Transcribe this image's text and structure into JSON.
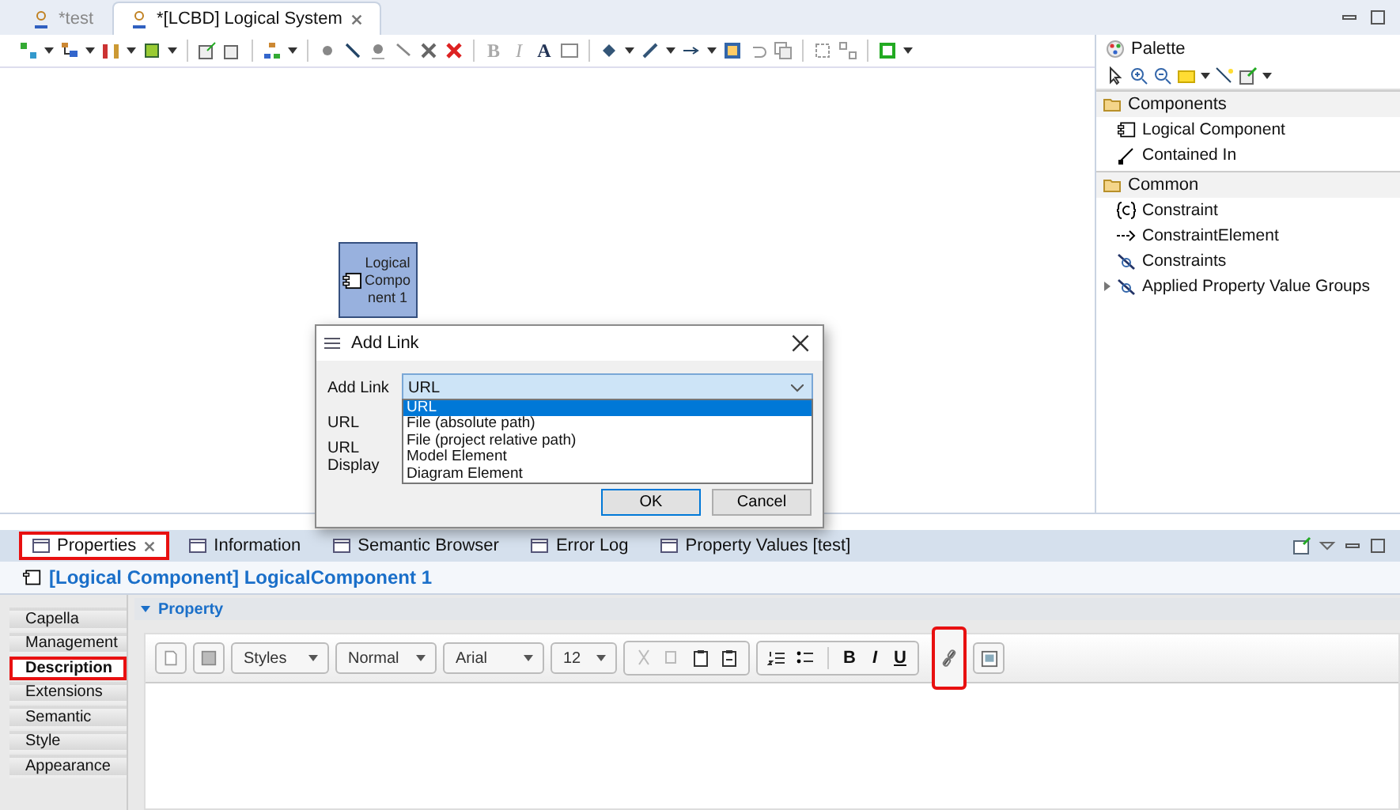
{
  "editor_tabs": [
    {
      "label": "*test",
      "selected": false
    },
    {
      "label": "*[LCBD] Logical System",
      "selected": true
    }
  ],
  "diagram_toolbar": {
    "format_letters": [
      "B",
      "I",
      "A"
    ]
  },
  "diagram": {
    "node_label": "LogicalComponent 1"
  },
  "palette": {
    "title": "Palette",
    "drawers": [
      {
        "label": "Components",
        "items": [
          {
            "label": "Logical Component",
            "kind": "component"
          },
          {
            "label": "Contained In",
            "kind": "link"
          }
        ]
      },
      {
        "label": "Common",
        "items": [
          {
            "label": "Constraint",
            "kind": "constraint"
          },
          {
            "label": "ConstraintElement",
            "kind": "arrow"
          },
          {
            "label": "Constraints",
            "kind": "filter"
          },
          {
            "label": "Applied Property Value Groups",
            "kind": "group"
          }
        ]
      }
    ]
  },
  "dialog": {
    "title": "Add Link",
    "fields": [
      "Add Link",
      "URL",
      "URL Display"
    ],
    "combo_value": "URL",
    "options": [
      {
        "label": "URL",
        "selected": true
      },
      {
        "label": "File (absolute path)",
        "selected": false
      },
      {
        "label": "File (project relative path)",
        "selected": false
      },
      {
        "label": "Model Element",
        "selected": false
      },
      {
        "label": "Diagram Element",
        "selected": false
      }
    ],
    "buttons": [
      "OK",
      "Cancel"
    ]
  },
  "views": {
    "tabs": [
      {
        "label": "Properties",
        "selected": true,
        "highlighted": true
      },
      {
        "label": "Information",
        "selected": false,
        "highlighted": false
      },
      {
        "label": "Semantic Browser",
        "selected": false,
        "highlighted": false
      },
      {
        "label": "Error Log",
        "selected": false,
        "highlighted": false
      },
      {
        "label": "Property Values [test]",
        "selected": false,
        "highlighted": false
      }
    ]
  },
  "properties": {
    "title": "[Logical Component] LogicalComponent 1",
    "side_tabs": [
      {
        "label": "Capella",
        "selected": false,
        "highlighted": false
      },
      {
        "label": "Management",
        "selected": false,
        "highlighted": false
      },
      {
        "label": "Description",
        "selected": true,
        "highlighted": true
      },
      {
        "label": "Extensions",
        "selected": false,
        "highlighted": false
      },
      {
        "label": "Semantic",
        "selected": false,
        "highlighted": false
      },
      {
        "label": "Style",
        "selected": false,
        "highlighted": false
      },
      {
        "label": "Appearance",
        "selected": false,
        "highlighted": false
      }
    ],
    "section": "Property",
    "editor": {
      "combos": [
        "Styles",
        "Normal",
        "Arial",
        "12"
      ],
      "format_letters": [
        "B",
        "I",
        "U"
      ],
      "link_highlighted": true
    }
  }
}
